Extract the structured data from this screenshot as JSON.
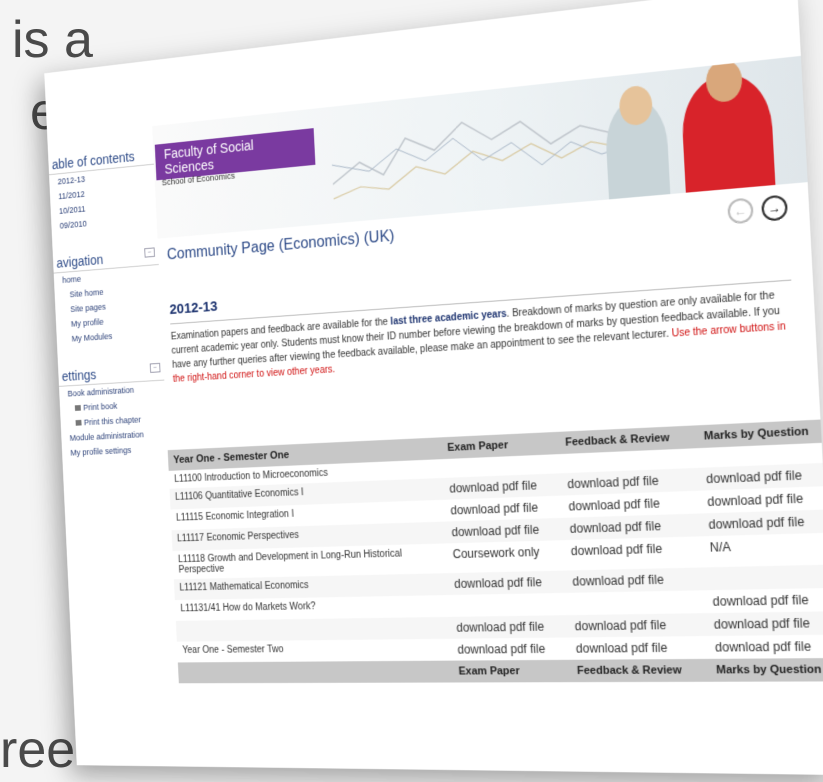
{
  "slide": {
    "text_top": "is a",
    "text_mid": "e",
    "text_bottom": "ree"
  },
  "sidebar": {
    "toc": {
      "title": "able of contents",
      "items": [
        "2012-13",
        "11/2012",
        "10/2011",
        "09/2010"
      ]
    },
    "navigation": {
      "title": "avigation",
      "items": [
        "home",
        "Site home",
        "Site pages",
        "My profile",
        "My Modules"
      ]
    },
    "settings": {
      "title": "ettings",
      "book_admin": "Book administration",
      "print_book": "Print book",
      "print_chapter": "Print this chapter",
      "module_admin": "Module administration",
      "profile_settings": "My profile settings"
    }
  },
  "banner": {
    "faculty": "Faculty of Social Sciences",
    "school": "School of Economics"
  },
  "main": {
    "heading": "Community Page (Economics) (UK)",
    "prev_arrow": "←",
    "next_arrow": "→",
    "year": "2012-13",
    "intro_1": "Examination papers and feedback are available for the ",
    "intro_bold": "last three academic years",
    "intro_2": ". Breakdown of marks by question are only available for the current academic year only. Students must know their ID number before viewing the breakdown of marks by question feedback available. If you have any further queries after viewing the feedback available, please make an appointment to see the relevant lecturer. ",
    "intro_red": "Use the arrow buttons in the right-hand corner to view other years."
  },
  "table": {
    "headers": [
      "Year One - Semester One",
      "Exam Paper",
      "Feedback & Review",
      "Marks by Question"
    ],
    "rows": [
      [
        "L11100 Introduction to Microeconomics",
        "",
        "",
        ""
      ],
      [
        "L11106 Quantitative Economics I",
        "download pdf file",
        "download pdf file",
        "download pdf file"
      ],
      [
        "L11115 Economic Integration I",
        "download pdf file",
        "download pdf file",
        "download pdf file"
      ],
      [
        "L11117 Economic Perspectives",
        "download pdf file",
        "download pdf file",
        "download pdf file"
      ],
      [
        "L11118 Growth and Development in Long-Run Historical Perspective",
        "Coursework only",
        "download pdf file",
        "N/A"
      ],
      [
        "L11121 Mathematical Economics",
        "download pdf file",
        "download pdf file",
        ""
      ],
      [
        "L11131/41 How do Markets Work?",
        "",
        "",
        "download pdf file"
      ],
      [
        "",
        "download pdf file",
        "download pdf file",
        "download pdf file"
      ],
      [
        "Year One - Semester Two",
        "download pdf file",
        "download pdf file",
        "download pdf file"
      ]
    ],
    "footer_headers": [
      "",
      "Exam Paper",
      "Feedback & Review",
      "Marks by Question"
    ]
  }
}
